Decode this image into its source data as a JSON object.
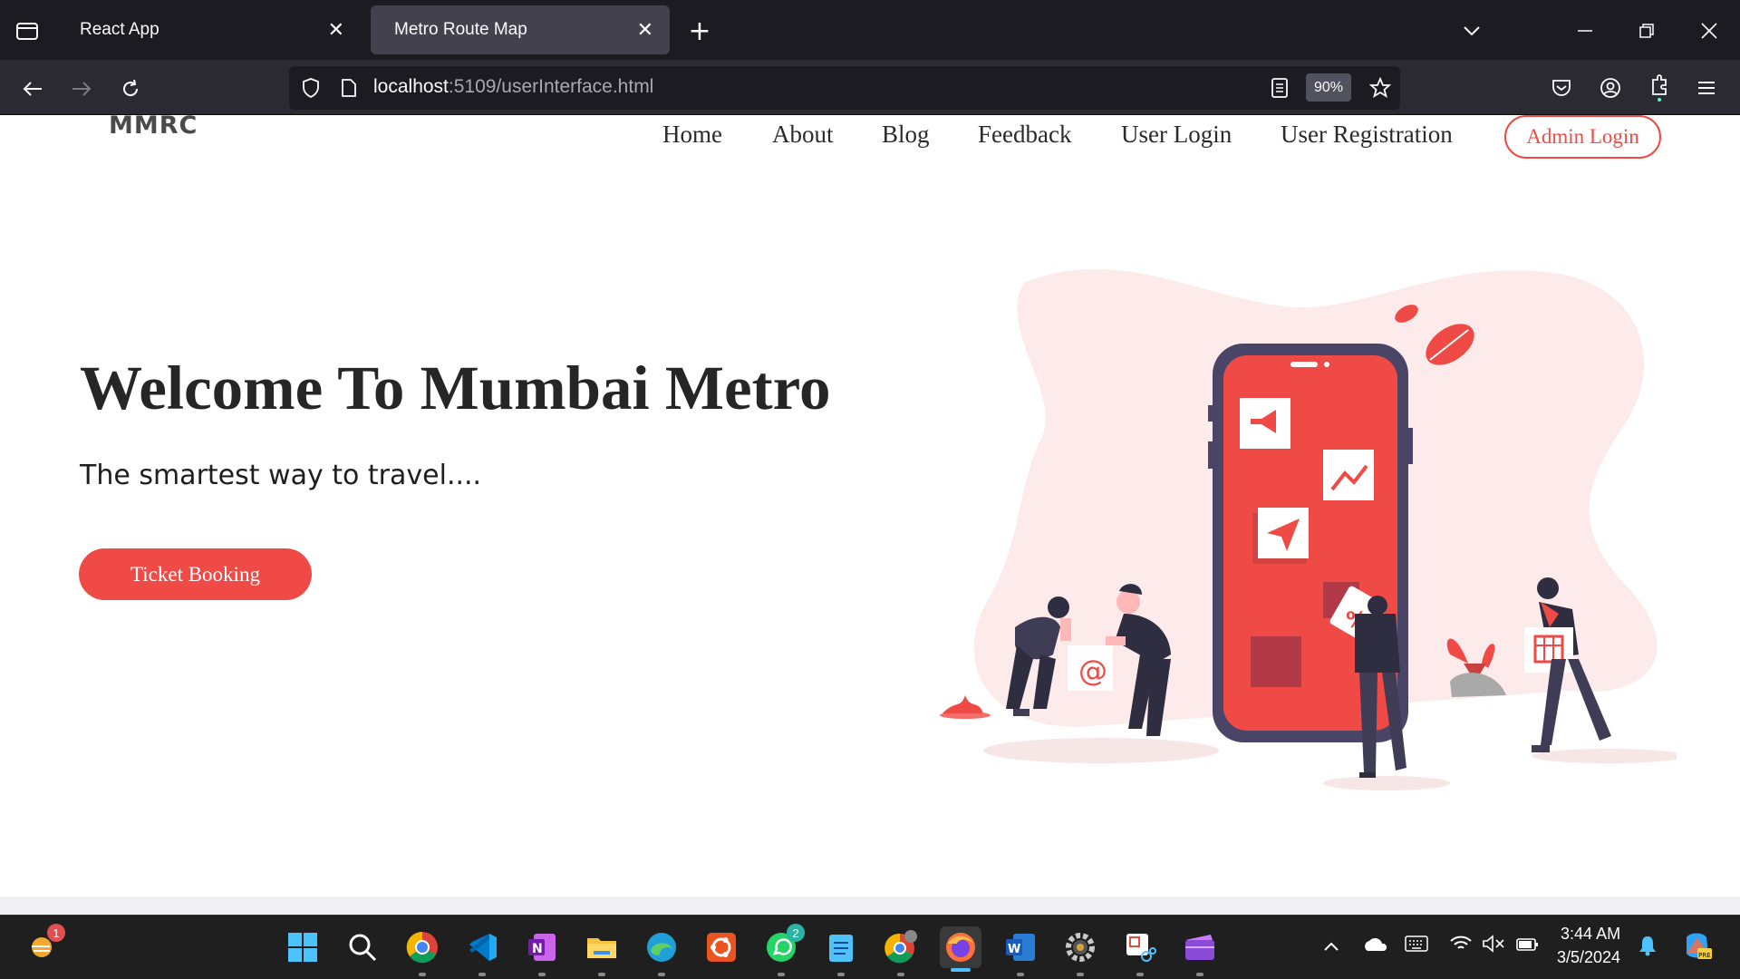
{
  "browser": {
    "tabs": [
      {
        "label": "React App",
        "active": false
      },
      {
        "label": "Metro Route Map",
        "active": true
      }
    ],
    "url_host": "localhost",
    "url_rest": ":5109/userInterface.html",
    "zoom": "90%"
  },
  "site": {
    "logo": "MMRC",
    "nav": [
      "Home",
      "About",
      "Blog",
      "Feedback",
      "User Login",
      "User Registration"
    ],
    "admin_login": "Admin Login",
    "hero_title": "Welcome To Mumbai Metro",
    "hero_subtitle": "The smartest way to travel....",
    "cta": "Ticket Booking",
    "accent_color": "#ef4a45"
  },
  "taskbar": {
    "notification_badge": "1",
    "whatsapp_badge": "2",
    "time": "3:44 AM",
    "date": "3/5/2024",
    "apps": [
      "start-icon",
      "search-icon",
      "chrome-icon",
      "vscode-icon",
      "onenote-icon",
      "file-explorer-icon",
      "edge-icon",
      "ubuntu-icon",
      "whatsapp-icon",
      "notepad-icon",
      "chrome-profile-icon",
      "firefox-icon",
      "word-icon",
      "settings-app-icon",
      "snipping-tool-icon",
      "clipchamp-icon"
    ]
  }
}
